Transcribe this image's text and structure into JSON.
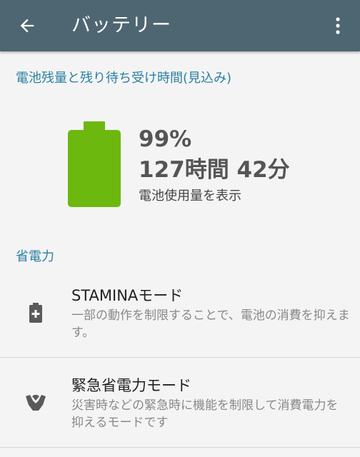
{
  "appbar": {
    "title": "バッテリー",
    "back_icon": "arrow-left-icon",
    "overflow_icon": "more-vertical-icon",
    "background_color": "#4e6672"
  },
  "battery": {
    "section_title": "電池残量と残り待ち受け時間(見込み)",
    "percent": "99%",
    "level": 0.99,
    "time_remaining": "127時間 42分",
    "usage_link": "電池使用量を表示",
    "battery_color": "#6cb80f",
    "accent_color": "#2b7fa3"
  },
  "power_saving": {
    "section_title": "省電力",
    "items": [
      {
        "title": "STAMINAモード",
        "description": "一部の動作を制限することで、電池の消費を抑えます。",
        "icon": "battery-plus-icon"
      },
      {
        "title": "緊急省電力モード",
        "description": "災害時などの緊急時に機能を制限して消費電力を抑えるモードです",
        "icon": "emergency-hands-icon"
      }
    ]
  }
}
